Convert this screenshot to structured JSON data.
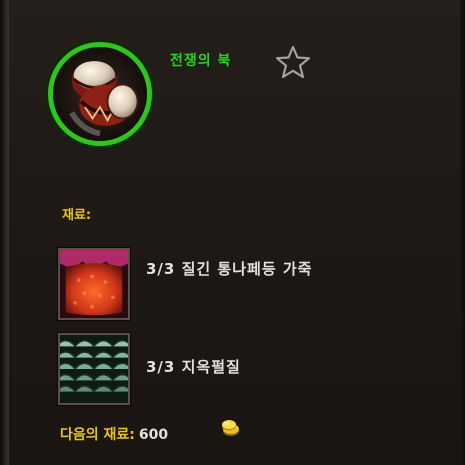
{
  "recipe": {
    "name": "전쟁의 북",
    "icon": "war-drums-icon",
    "favorite_icon": "star-outline-icon",
    "name_color": "#24d61c",
    "border_color": "#2ec51f"
  },
  "reagents": {
    "label": "재료:",
    "items": [
      {
        "count": "3/3",
        "name": "질긴 통나페등 가죽",
        "icon": "red-leather-icon"
      },
      {
        "count": "3/3",
        "name": "지옥펄질",
        "icon": "green-scale-icon"
      }
    ]
  },
  "cost": {
    "label": "다음의 재료:",
    "value": "600",
    "icon": "coin-icon",
    "label_color": "#e8c417"
  }
}
